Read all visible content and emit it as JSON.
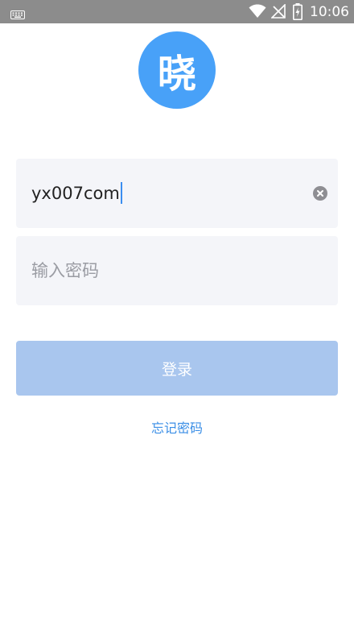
{
  "status_bar": {
    "time": "10:06",
    "icons": [
      "keyboard-icon",
      "wifi-icon",
      "no-sim-signal-icon",
      "battery-charging-icon"
    ]
  },
  "logo": {
    "text": "晓"
  },
  "login_form": {
    "username": {
      "value": "yx007com",
      "clear_icon": "clear-circle-icon"
    },
    "password": {
      "placeholder": "输入密码",
      "value": ""
    },
    "submit_label": "登录",
    "forgot_label": "忘记密码"
  },
  "colors": {
    "status_bar_bg": "#8c8c8c",
    "brand_blue": "#48a1f8",
    "button_disabled_bg": "#a9c6ee",
    "field_bg": "#f4f5f9",
    "link": "#3a8ee6",
    "cursor": "#3b8ef0"
  }
}
